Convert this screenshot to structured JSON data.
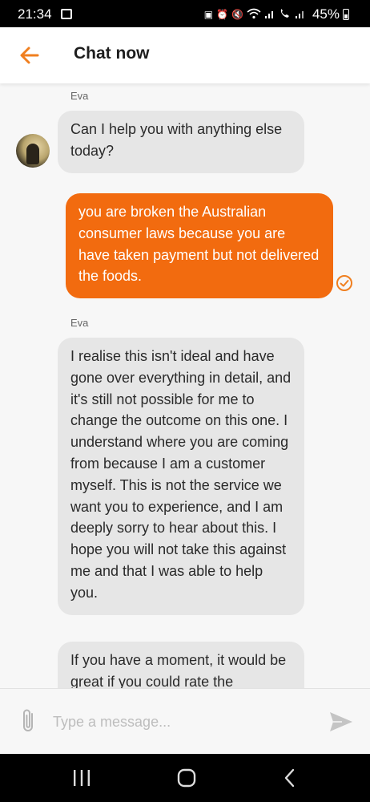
{
  "status_bar": {
    "time": "21:34",
    "battery": "45%",
    "icons": [
      "image-icon",
      "battery-saver-icon",
      "alarm-icon",
      "mute-icon",
      "wifi-icon",
      "signal-icon",
      "volte-icon",
      "signal-icon",
      "battery-icon"
    ]
  },
  "header": {
    "title": "Chat now",
    "back_icon": "arrow-left-icon",
    "accent_color": "#f07f1f"
  },
  "messages": [
    {
      "from": "agent",
      "sender": "Eva",
      "text": "Can I help you with anything else today?",
      "show_avatar": true
    },
    {
      "from": "user",
      "text": "you are broken the Australian consumer laws because you are have taken payment but not delivered the foods.",
      "status_icon": "check-circle-icon"
    },
    {
      "from": "agent",
      "sender": "Eva",
      "text": "I realise this isn't ideal and have gone over everything in detail, and it's still not possible for me to change the outcome on this one. I understand where you are coming from because I am a customer myself. This is not the service we want you to experience, and I am deeply sorry to hear about this. I hope you will not take this against me and that I was able to help you."
    },
    {
      "from": "agent",
      "text": "If you have a moment, it would be great if you could rate the"
    }
  ],
  "colors": {
    "user_bubble": "#f26b0f",
    "agent_bubble": "#e6e6e6",
    "background": "#f7f7f7"
  },
  "composer": {
    "placeholder": "Type a message...",
    "value": "",
    "attach_icon": "paperclip-icon",
    "send_icon": "send-icon"
  },
  "nav_bar": {
    "icons": [
      "recents-icon",
      "home-icon",
      "back-icon"
    ]
  }
}
